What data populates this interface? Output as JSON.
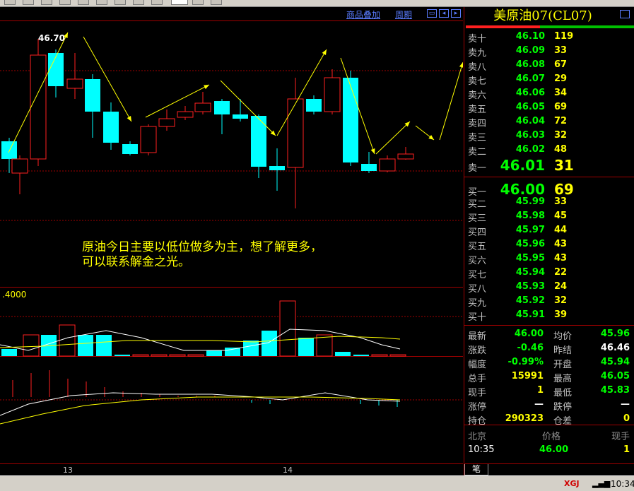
{
  "toolbar": {
    "buttons": 11,
    "active_index": 8
  },
  "chart_header": {
    "overlay_link": "商品叠加",
    "period_link": "周期"
  },
  "chart": {
    "high_label": "46.70",
    "volume_axis_label": ".4000",
    "annotation_line1": "原油今日主要以低位做多为主，想了解更多，",
    "annotation_line2": "可以联系解金之光。",
    "date_labels": [
      "13",
      "14"
    ]
  },
  "quote": {
    "title": "美原油07(CL07)",
    "sell": [
      {
        "label": "卖十",
        "price": "46.10",
        "vol": "119"
      },
      {
        "label": "卖九",
        "price": "46.09",
        "vol": "33"
      },
      {
        "label": "卖八",
        "price": "46.08",
        "vol": "67"
      },
      {
        "label": "卖七",
        "price": "46.07",
        "vol": "29"
      },
      {
        "label": "卖六",
        "price": "46.06",
        "vol": "34"
      },
      {
        "label": "卖五",
        "price": "46.05",
        "vol": "69"
      },
      {
        "label": "卖四",
        "price": "46.04",
        "vol": "72"
      },
      {
        "label": "卖三",
        "price": "46.03",
        "vol": "32"
      },
      {
        "label": "卖二",
        "price": "46.02",
        "vol": "48"
      },
      {
        "label": "卖一",
        "price": "46.01",
        "vol": "31"
      }
    ],
    "buy": [
      {
        "label": "买一",
        "price": "46.00",
        "vol": "69"
      },
      {
        "label": "买二",
        "price": "45.99",
        "vol": "33"
      },
      {
        "label": "买三",
        "price": "45.98",
        "vol": "45"
      },
      {
        "label": "买四",
        "price": "45.97",
        "vol": "44"
      },
      {
        "label": "买五",
        "price": "45.96",
        "vol": "43"
      },
      {
        "label": "买六",
        "price": "45.95",
        "vol": "43"
      },
      {
        "label": "买七",
        "price": "45.94",
        "vol": "22"
      },
      {
        "label": "买八",
        "price": "45.93",
        "vol": "24"
      },
      {
        "label": "买九",
        "price": "45.92",
        "vol": "32"
      },
      {
        "label": "买十",
        "price": "45.91",
        "vol": "39"
      }
    ],
    "stats": [
      {
        "l1": "最新",
        "v1": "46.00",
        "c1": "green",
        "l2": "均价",
        "v2": "45.96",
        "c2": "green"
      },
      {
        "l1": "涨跌",
        "v1": "-0.46",
        "c1": "green",
        "l2": "昨结",
        "v2": "46.46",
        "c2": "white"
      },
      {
        "l1": "幅度",
        "v1": "-0.99%",
        "c1": "green",
        "l2": "开盘",
        "v2": "45.94",
        "c2": "green"
      },
      {
        "l1": "总手",
        "v1": "15991",
        "c1": "yellow",
        "l2": "最高",
        "v2": "46.05",
        "c2": "green"
      },
      {
        "l1": "现手",
        "v1": "1",
        "c1": "yellow",
        "l2": "最低",
        "v2": "45.83",
        "c2": "green"
      },
      {
        "l1": "涨停",
        "v1": "—",
        "c1": "white",
        "l2": "跌停",
        "v2": "—",
        "c2": "white"
      },
      {
        "l1": "持仓",
        "v1": "290323",
        "c1": "yellow",
        "l2": "仓差",
        "v2": "0",
        "c2": "yellow"
      }
    ],
    "tick_header": {
      "place": "北京",
      "price": "价格",
      "hand": "现手"
    },
    "tick": {
      "time": "10:35",
      "price": "46.00",
      "hand": "1"
    },
    "tab": "笔"
  },
  "status_bar": {
    "brand": "XGJ",
    "clock": "10:34"
  },
  "colors": {
    "up": "#ff2020",
    "down": "#00ffff",
    "grid": "#a00000",
    "accent": "#ffff00"
  }
}
